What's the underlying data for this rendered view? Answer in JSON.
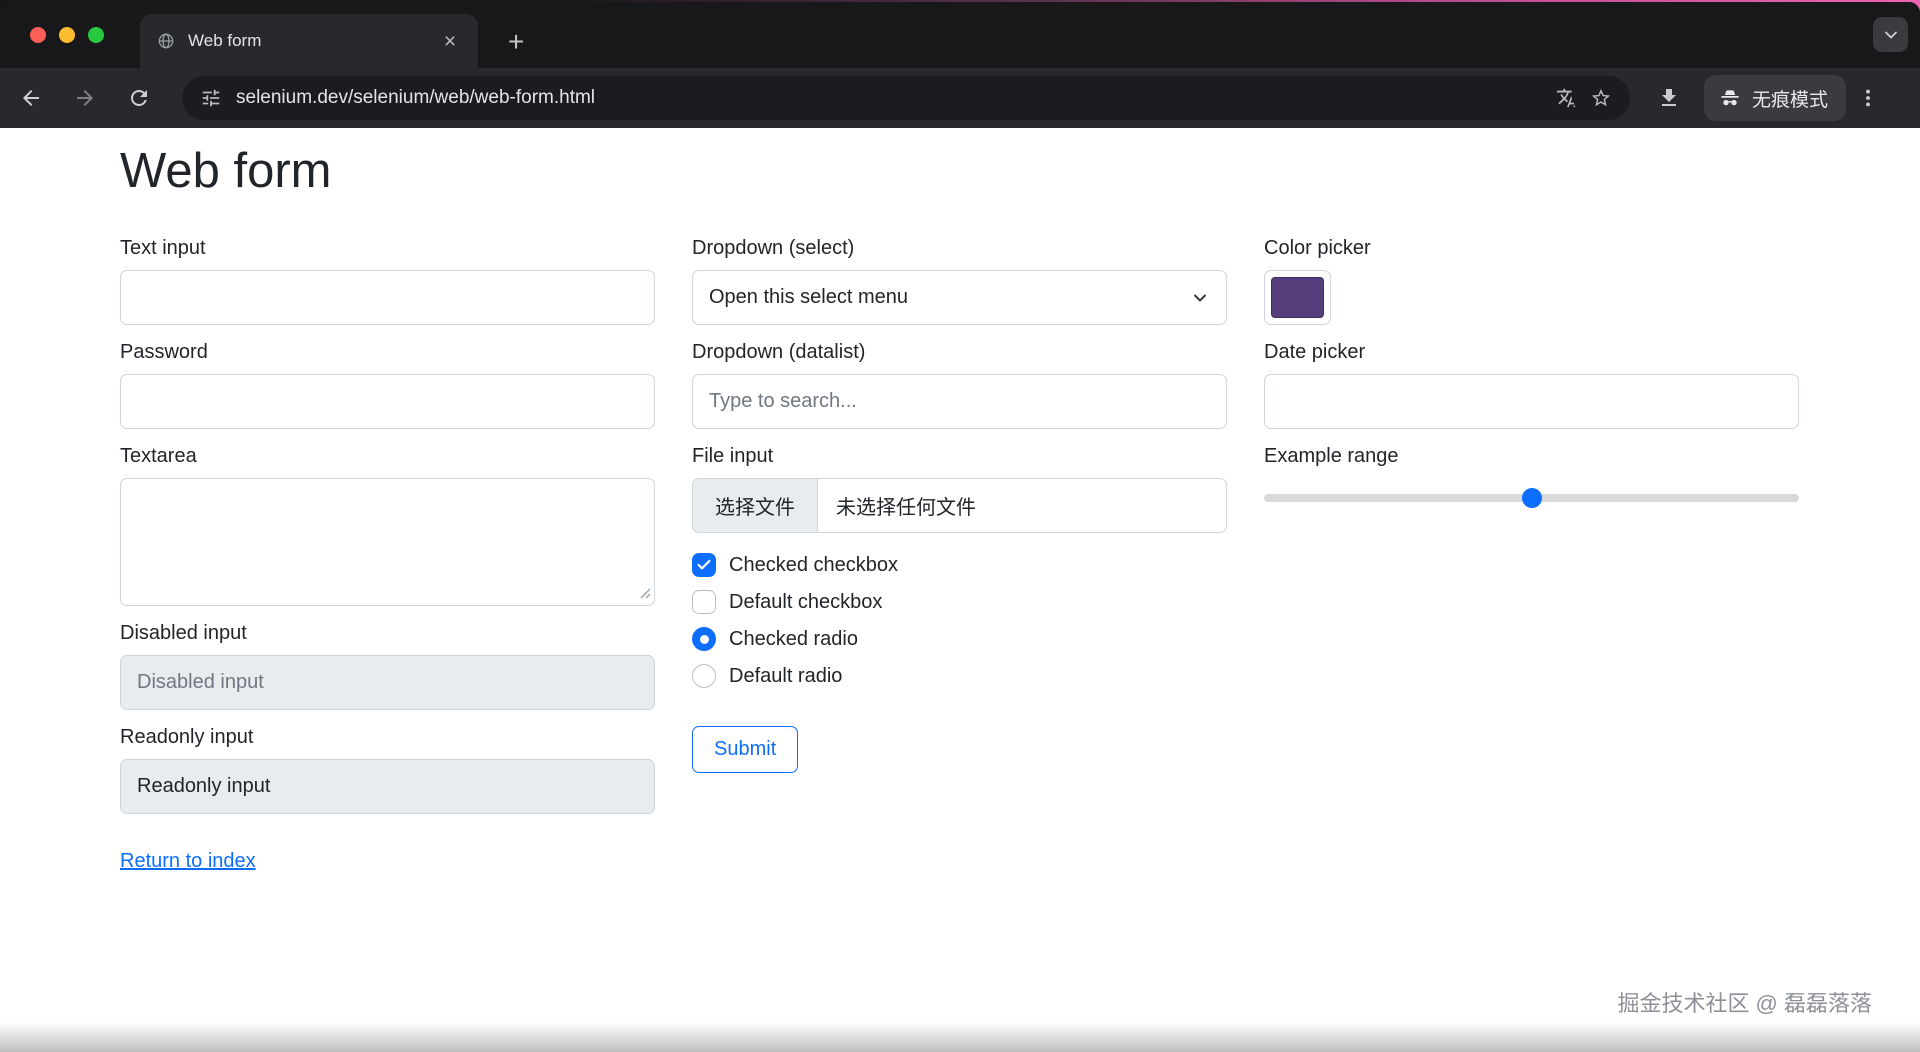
{
  "browser": {
    "tab_title": "Web form",
    "url": "selenium.dev/selenium/web/web-form.html",
    "incognito_label": "无痕模式",
    "new_tab_glyph": "+",
    "close_glyph": "×",
    "icons": [
      "globe-favicon",
      "tab-close",
      "new-tab-plus",
      "tab-search-chevron",
      "back-arrow",
      "forward-arrow",
      "reload",
      "site-info-tune",
      "translate",
      "bookmark-star",
      "download",
      "incognito",
      "menu-dots"
    ]
  },
  "form": {
    "heading": "Web form",
    "text_input": {
      "label": "Text input",
      "value": ""
    },
    "password": {
      "label": "Password",
      "value": ""
    },
    "textarea": {
      "label": "Textarea",
      "value": ""
    },
    "disabled_input": {
      "label": "Disabled input",
      "placeholder": "Disabled input"
    },
    "readonly_input": {
      "label": "Readonly input",
      "value": "Readonly input"
    },
    "return_link": "Return to index",
    "dropdown_select": {
      "label": "Dropdown (select)",
      "selected": "Open this select menu"
    },
    "dropdown_datalist": {
      "label": "Dropdown (datalist)",
      "placeholder": "Type to search..."
    },
    "file_input": {
      "label": "File input",
      "button": "选择文件",
      "status": "未选择任何文件"
    },
    "checkboxes": [
      {
        "label": "Checked checkbox",
        "checked": true
      },
      {
        "label": "Default checkbox",
        "checked": false
      }
    ],
    "radios": [
      {
        "label": "Checked radio",
        "checked": true
      },
      {
        "label": "Default radio",
        "checked": false
      }
    ],
    "submit_label": "Submit",
    "color_picker": {
      "label": "Color picker",
      "value": "#563d7c"
    },
    "date_picker": {
      "label": "Date picker",
      "value": ""
    },
    "range": {
      "label": "Example range",
      "percent": 50
    }
  },
  "watermark": "掘金技术社区 @ 磊磊落落",
  "colors": {
    "accent": "#0d6efd",
    "link": "#0d6efd",
    "checked": "#0d6efd"
  }
}
